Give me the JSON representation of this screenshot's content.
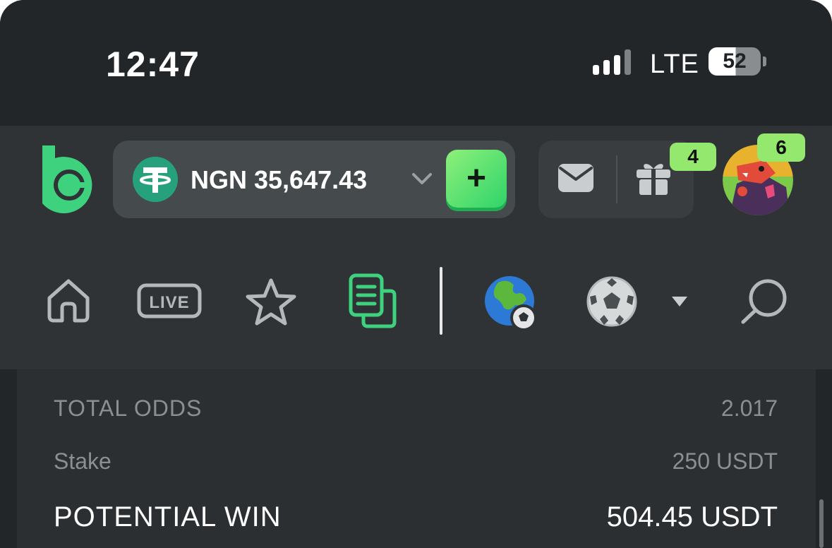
{
  "status_bar": {
    "time": "12:47",
    "network": "LTE",
    "battery": "52"
  },
  "header": {
    "wallet": {
      "currency_icon": "tether-icon",
      "balance": "NGN 35,647.43",
      "deposit_label": "+"
    },
    "notifications": {
      "mail_icon": "mail-icon",
      "gift_icon": "gift-icon",
      "gift_badge": "4"
    },
    "avatar": {
      "badge": "6"
    }
  },
  "nav": {
    "items": [
      {
        "icon": "home-icon"
      },
      {
        "icon": "live-icon",
        "label": "LIVE"
      },
      {
        "icon": "star-icon"
      },
      {
        "icon": "betslip-icon",
        "active": true
      },
      {
        "icon": "globe-soccer-icon"
      },
      {
        "icon": "soccer-ball-icon"
      },
      {
        "icon": "caret-down-icon"
      },
      {
        "icon": "search-icon"
      }
    ]
  },
  "bet_summary": {
    "total_odds_label": "TOTAL ODDS",
    "total_odds_value": "2.017",
    "stake_label": "Stake",
    "stake_value": "250 USDT",
    "potential_win_label": "POTENTIAL WIN",
    "potential_win_value": "504.45 USDT"
  },
  "colors": {
    "accent": "#3ed27e",
    "deposit": "#5ee07a",
    "badge": "#93e86d",
    "background": "#232628",
    "header": "#2f3335"
  }
}
